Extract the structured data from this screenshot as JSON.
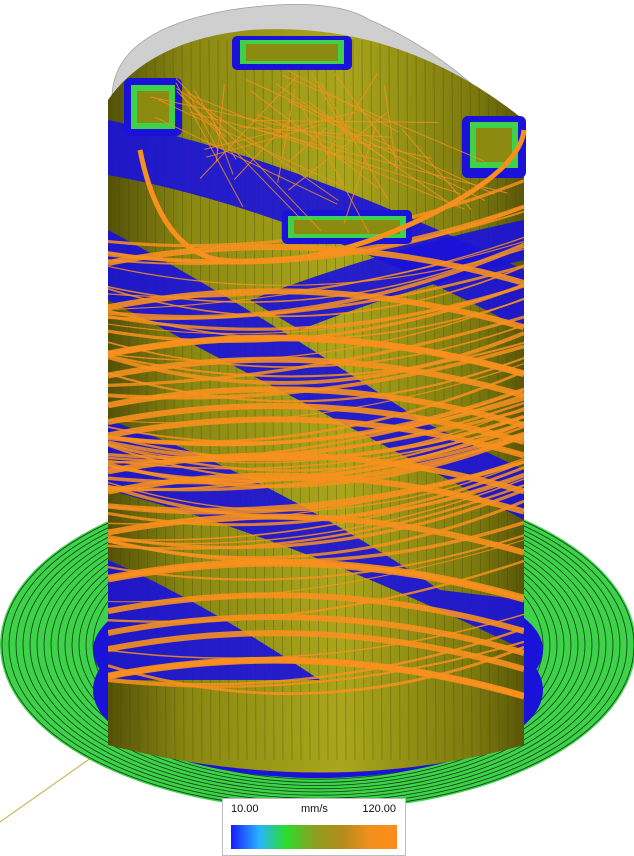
{
  "legend": {
    "min_label": "10.00",
    "unit_label": "mm/s",
    "max_label": "120.00",
    "min_value": 10.0,
    "max_value": 120.0,
    "gradient_colors": [
      "#1a1aff",
      "#28b4ff",
      "#2cdc2c",
      "#8ca020",
      "#b48c1c",
      "#f0901e",
      "#ff8c1a"
    ]
  },
  "colors": {
    "brim_green": "#3ed24a",
    "brim_line": "#0d3d12",
    "slow_blue": "#1a12d8",
    "fast_orange": "#f8901e",
    "wall_olive": "#8c8a10",
    "wall_dark": "#4a4808",
    "ghost_gray": "#c8c8c8",
    "axis_yellow": "#bfae3c"
  },
  "viewport": {
    "content": "toolpath-preview",
    "color_scheme": "speed"
  }
}
